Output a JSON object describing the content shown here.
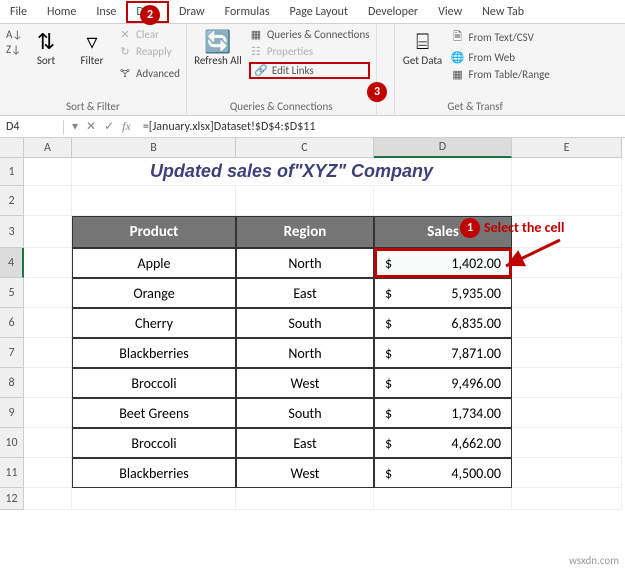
{
  "tabs": {
    "file": "File",
    "home": "Home",
    "insert": "Inse",
    "data": "Data",
    "draw": "Draw",
    "formulas": "Formulas",
    "pagelayout": "Page Layout",
    "developer": "Developer",
    "view": "View",
    "newtab": "New Tab"
  },
  "ribbon": {
    "sort_az": "A→Z",
    "sort_za": "Z→A",
    "sort": "Sort",
    "filter": "Filter",
    "clear": "Clear",
    "reapply": "Reapply",
    "advanced": "Advanced",
    "sort_filter_group": "Sort & Filter",
    "refresh": "Refresh All",
    "queries": "Queries & Connections",
    "properties": "Properties",
    "editlinks": "Edit Links",
    "qc_group": "Queries & Connections",
    "getdata": "Get Data",
    "fromtext": "From Text/CSV",
    "fromweb": "From Web",
    "fromtable": "From Table/Range",
    "gt_group": "Get & Transf"
  },
  "namebox": "D4",
  "formula": "=[January.xlsx]Dataset!$D$4:$D$11",
  "cols": {
    "A": "A",
    "B": "B",
    "C": "C",
    "D": "D",
    "E": "E"
  },
  "rows": [
    "1",
    "2",
    "3",
    "4",
    "5",
    "6",
    "7",
    "8",
    "9",
    "10",
    "11",
    "12"
  ],
  "title": "Updated sales of\"XYZ\" Company",
  "headers": {
    "product": "Product",
    "region": "Region",
    "sales": "Sales"
  },
  "data": [
    {
      "product": "Apple",
      "region": "North",
      "sales": "1,402.00"
    },
    {
      "product": "Orange",
      "region": "East",
      "sales": "5,935.00"
    },
    {
      "product": "Cherry",
      "region": "South",
      "sales": "6,835.00"
    },
    {
      "product": "Blackberries",
      "region": "North",
      "sales": "7,871.00"
    },
    {
      "product": "Broccoli",
      "region": "West",
      "sales": "9,496.00"
    },
    {
      "product": "Beet Greens",
      "region": "South",
      "sales": "1,734.00"
    },
    {
      "product": "Broccoli",
      "region": "East",
      "sales": "4,662.00"
    },
    {
      "product": "Blackberries",
      "region": "West",
      "sales": "4,500.00"
    }
  ],
  "currency": "$",
  "callout": "Select the cell",
  "markers": {
    "m1": "1",
    "m2": "2",
    "m3": "3"
  },
  "watermark": "wsxdn.com"
}
